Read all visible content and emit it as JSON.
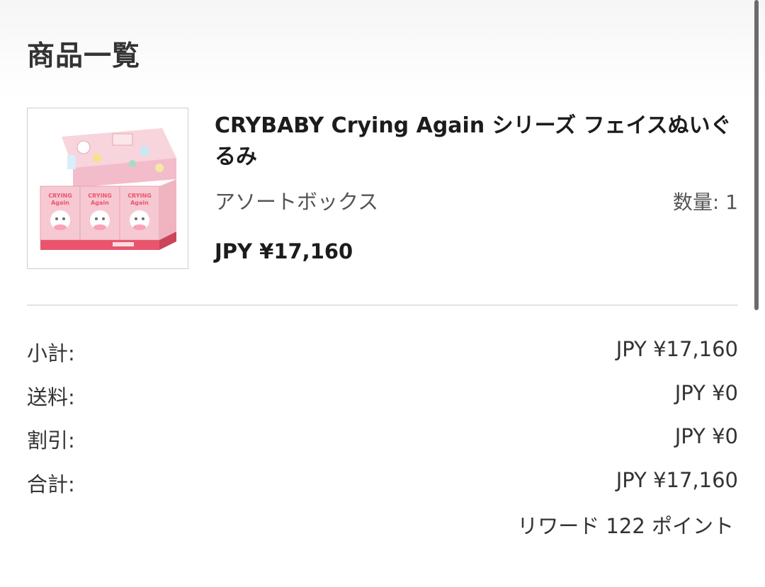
{
  "section_title": "商品一覧",
  "product": {
    "name": "CRYBABY Crying Again シリーズ フェイスぬいぐるみ",
    "variant": "アソートボックス",
    "quantity_label": "数量: 1",
    "price": "JPY ¥17,160",
    "image_box_text": "CRYING Again"
  },
  "summary": {
    "subtotal_label": "小計:",
    "subtotal_value": "JPY ¥17,160",
    "shipping_label": "送料:",
    "shipping_value": "JPY ¥0",
    "discount_label": "割引:",
    "discount_value": "JPY ¥0",
    "total_label": "合計:",
    "total_value": "JPY ¥17,160"
  },
  "reward_text": "リワード 122 ポイント",
  "colors": {
    "text_primary": "#1c1c1c",
    "text_secondary": "#555555",
    "divider": "#e2e2e2",
    "box_pink": "#f4b6c2",
    "box_accent": "#e9556e"
  }
}
